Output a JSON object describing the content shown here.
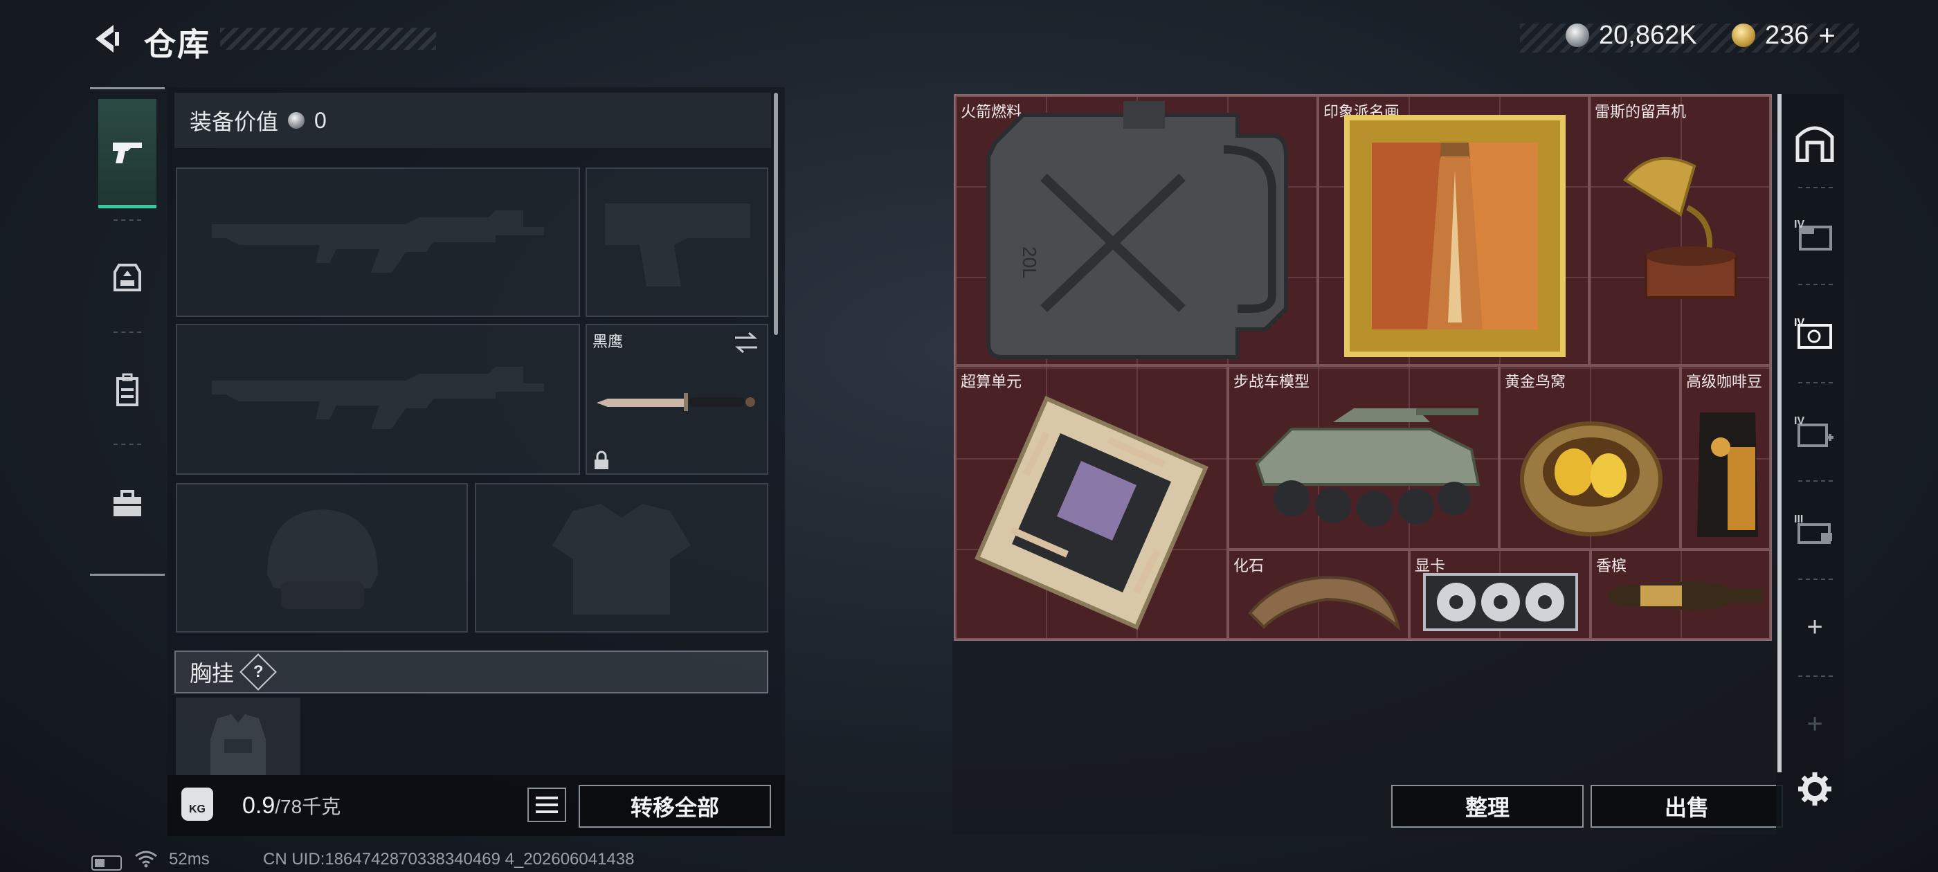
{
  "header": {
    "title": "仓库",
    "silver_amount": "20,862K",
    "gold_amount": "236",
    "gold_plus": "+"
  },
  "equipment": {
    "value_label": "装备价值",
    "value": "0",
    "melee_label": "黑鹰",
    "chest_label": "胸挂",
    "chest_help": "?",
    "weight_current": "0.9",
    "weight_max": "/78千克",
    "kg_badge": "KG",
    "transfer_all": "转移全部"
  },
  "stash": {
    "items": [
      {
        "label": "火箭燃料",
        "icon": "jerrycan-icon"
      },
      {
        "label": "印象派名画",
        "icon": "painting-icon"
      },
      {
        "label": "雷斯的留声机",
        "icon": "gramophone-icon"
      },
      {
        "label": "超算单元",
        "icon": "circuit-board-icon"
      },
      {
        "label": "步战车模型",
        "icon": "armored-vehicle-icon"
      },
      {
        "label": "黄金鸟窝",
        "icon": "golden-nest-icon"
      },
      {
        "label": "高级咖啡豆",
        "icon": "coffee-bag-icon"
      },
      {
        "label": "化石",
        "icon": "fossil-claw-icon"
      },
      {
        "label": "显卡",
        "icon": "graphics-card-icon"
      },
      {
        "label": "香槟",
        "icon": "champagne-icon"
      }
    ],
    "sort_button": "整理",
    "sell_button": "出售"
  },
  "right_rail": {
    "tier_labels": [
      "IV",
      "IV",
      "IV",
      "III"
    ],
    "add": "+"
  },
  "status_bar": {
    "latency": "52ms",
    "uid": "CN UID:1864742870338340469 4_202606041438"
  },
  "colors": {
    "accent_green": "#39c7a6",
    "stash_bg": "#4a2226"
  }
}
